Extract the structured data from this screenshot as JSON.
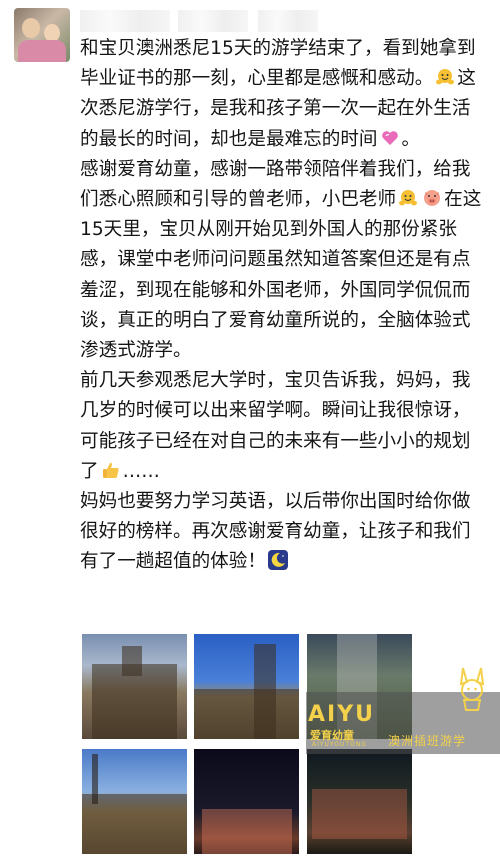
{
  "post": {
    "text_parts": [
      "和宝贝澳洲悉尼15天的游学结束了，看到她拿到毕业证书的那一刻，心里都是感慨和感动。",
      "这次悉尼游学行，是我和孩子第一次一起在外生活的最长的时间，却也是最难忘的时间",
      "。\n感谢爱育幼童，感谢一路带领陪伴着我们，给我们悉心照顾和引导的曾老师，小巴老师",
      "在这15天里，宝贝从刚开始见到外国人的那份紧张感，课堂中老师问问题虽然知道答案但还是有点羞涩，到现在能够和外国老师，外国同学侃侃而谈，真正的明白了爱育幼童所说的，全脑体验式渗透式游学。\n前几天参观悉尼大学时，宝贝告诉我，妈妈，我几岁的时候可以出来留学啊。瞬间让我很惊讶，可能孩子已经在对自己的未来有一些小小的规划了",
      "……\n妈妈也要努力学习英语，以后带你出国时给你做很好的榜样。再次感谢爱育幼童，让孩子和我们有了一趟超值的体验！"
    ],
    "emojis": [
      "hug-emoji",
      "pink-heart-emoji",
      "hug-emoji",
      "pig-face-emoji",
      "thumbs-up-emoji",
      "crescent-moon-emoji"
    ]
  },
  "watermark": {
    "logo": "AIYU",
    "logo_cn": "爱育幼童",
    "logo_en": "AIYUYOUTONG",
    "slogan": "澳洲插班游学"
  },
  "colors": {
    "watermark_gold": "#f3d14a",
    "text": "#151515"
  }
}
